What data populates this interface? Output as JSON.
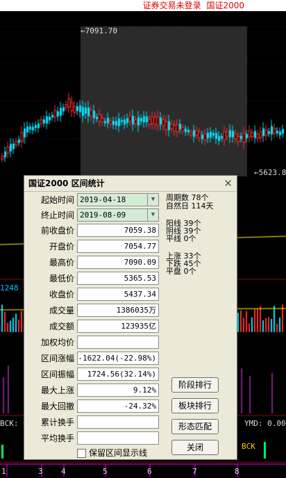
{
  "top_bar": {
    "status": "证券交易未登录",
    "index_name": "国证2000"
  },
  "chart_labels": {
    "high_marker": "7091.70",
    "low_marker": "5623.8",
    "volume_marker": "1248",
    "left_footer": "BCK: 0",
    "right_footer": "YMD: 0.00",
    "right_bottom": "BCK",
    "x_ticks": [
      "1",
      "3",
      "4",
      "5",
      "6",
      "7",
      "8"
    ]
  },
  "dialog": {
    "title": "国证2000 区间统计",
    "close": "✕",
    "start": {
      "label": "起始时间",
      "value": "2019-04-18"
    },
    "end": {
      "label": "终止时间",
      "value": "2019-08-09"
    },
    "stats": [
      {
        "label": "前收盘价",
        "value": "7059.38"
      },
      {
        "label": "开盘价",
        "value": "7054.77"
      },
      {
        "label": "最高价",
        "value": "7090.09"
      },
      {
        "label": "最低价",
        "value": "5365.53"
      },
      {
        "label": "收盘价",
        "value": "5437.34"
      },
      {
        "label": "成交量",
        "value": "1386035万"
      },
      {
        "label": "成交额",
        "value": "123935亿"
      },
      {
        "label": "加权均价",
        "value": ""
      },
      {
        "label": "区间涨幅",
        "value": "-1622.04(-22.98%)"
      },
      {
        "label": "区间振幅",
        "value": "1724.56(32.14%)"
      },
      {
        "label": "最大上涨",
        "value": "9.12%"
      },
      {
        "label": "最大回撤",
        "value": "-24.32%"
      },
      {
        "label": "累计换手",
        "value": ""
      },
      {
        "label": "平均换手",
        "value": ""
      }
    ],
    "periods": [
      "周期数 78个",
      "自然日 114天"
    ],
    "candles": [
      "阳线 39个",
      "阴线 39个",
      "平线 0个"
    ],
    "moves": [
      "上涨 33个",
      "下跌 45个",
      "平盘 0个"
    ],
    "buttons": [
      "阶段排行",
      "板块排行",
      "形态匹配",
      "关闭"
    ],
    "checkbox": "保留区间显示线"
  }
}
